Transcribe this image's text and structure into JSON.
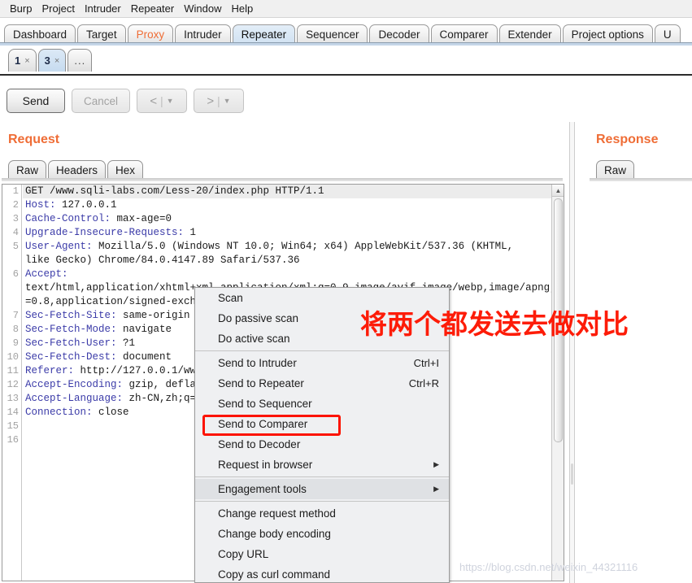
{
  "menubar": {
    "items": [
      {
        "label": "Burp"
      },
      {
        "label": "Project"
      },
      {
        "label": "Intruder"
      },
      {
        "label": "Repeater"
      },
      {
        "label": "Window"
      },
      {
        "label": "Help"
      }
    ]
  },
  "main_tabs": [
    {
      "label": "Dashboard",
      "selected": false,
      "accent": false
    },
    {
      "label": "Target",
      "selected": false,
      "accent": false
    },
    {
      "label": "Proxy",
      "selected": false,
      "accent": true
    },
    {
      "label": "Intruder",
      "selected": false,
      "accent": false
    },
    {
      "label": "Repeater",
      "selected": true,
      "accent": false
    },
    {
      "label": "Sequencer",
      "selected": false,
      "accent": false
    },
    {
      "label": "Decoder",
      "selected": false,
      "accent": false
    },
    {
      "label": "Comparer",
      "selected": false,
      "accent": false
    },
    {
      "label": "Extender",
      "selected": false,
      "accent": false
    },
    {
      "label": "Project options",
      "selected": false,
      "accent": false
    },
    {
      "label": "U",
      "selected": false,
      "accent": false
    }
  ],
  "repeater_tabs": [
    {
      "label": "1",
      "close": "×",
      "selected": false
    },
    {
      "label": "3",
      "close": "×",
      "selected": true
    }
  ],
  "repeater_tabs_more": "...",
  "toolbar": {
    "send_label": "Send",
    "cancel_label": "Cancel",
    "prev_chevron": "<",
    "next_chevron": ">",
    "separator": "|",
    "caret": "▼"
  },
  "request": {
    "title": "Request",
    "tabs": [
      {
        "label": "Raw",
        "selected": true
      },
      {
        "label": "Headers",
        "selected": false
      },
      {
        "label": "Hex",
        "selected": false
      }
    ],
    "line_numbers": [
      "1",
      "2",
      "3",
      "4",
      "5",
      "",
      "6",
      "",
      "",
      "7",
      "8",
      "9",
      "10",
      "11",
      "12",
      "13",
      "14",
      "15",
      "16"
    ],
    "lines": [
      {
        "header": "",
        "text": "GET /www.sqli-labs.com/Less-20/index.php HTTP/1.1",
        "first": true
      },
      {
        "header": "Host:",
        "text": " 127.0.0.1"
      },
      {
        "header": "Cache-Control:",
        "text": " max-age=0"
      },
      {
        "header": "Upgrade-Insecure-Requests:",
        "text": " 1"
      },
      {
        "header": "User-Agent:",
        "text": " Mozilla/5.0 (Windows NT 10.0; Win64; x64) AppleWebKit/537.36 (KHTML,"
      },
      {
        "header": "",
        "text": "like Gecko) Chrome/84.0.4147.89 Safari/537.36"
      },
      {
        "header": "Accept:",
        "text": ""
      },
      {
        "header": "",
        "text": "text/html,application/xhtml+xml,application/xml;q=0.9,image/avif,image/webp,image/apng,*/*;q"
      },
      {
        "header": "",
        "text": "=0.8,application/signed-exchange;v=b3;q=0.9"
      },
      {
        "header": "Sec-Fetch-Site:",
        "text": " same-origin"
      },
      {
        "header": "Sec-Fetch-Mode:",
        "text": " navigate"
      },
      {
        "header": "Sec-Fetch-User:",
        "text": " ?1"
      },
      {
        "header": "Sec-Fetch-Dest:",
        "text": " document"
      },
      {
        "header": "Referer:",
        "text": " http://127.0.0.1/www.sqli-labs.com/Less-20/index.php"
      },
      {
        "header": "Accept-Encoding:",
        "text": " gzip, deflate"
      },
      {
        "header": "Accept-Language:",
        "text": " zh-CN,zh;q=0.9"
      },
      {
        "header": "Connection:",
        "text": " close"
      },
      {
        "header": "",
        "text": ""
      },
      {
        "header": "",
        "text": ""
      }
    ]
  },
  "response": {
    "title": "Response",
    "tabs": [
      {
        "label": "Raw",
        "selected": true
      }
    ]
  },
  "context_menu": {
    "items": [
      {
        "label": "Scan",
        "accel": "",
        "submenu": false,
        "hover": false,
        "separator_after": false
      },
      {
        "label": "Do passive scan",
        "accel": "",
        "submenu": false,
        "hover": false,
        "separator_after": false
      },
      {
        "label": "Do active scan",
        "accel": "",
        "submenu": false,
        "hover": false,
        "separator_after": true
      },
      {
        "label": "Send to Intruder",
        "accel": "Ctrl+I",
        "submenu": false,
        "hover": false,
        "separator_after": false
      },
      {
        "label": "Send to Repeater",
        "accel": "Ctrl+R",
        "submenu": false,
        "hover": false,
        "separator_after": false
      },
      {
        "label": "Send to Sequencer",
        "accel": "",
        "submenu": false,
        "hover": false,
        "separator_after": false
      },
      {
        "label": "Send to Comparer",
        "accel": "",
        "submenu": false,
        "hover": false,
        "separator_after": false
      },
      {
        "label": "Send to Decoder",
        "accel": "",
        "submenu": false,
        "hover": false,
        "separator_after": false
      },
      {
        "label": "Request in browser",
        "accel": "",
        "submenu": true,
        "hover": false,
        "separator_after": true
      },
      {
        "label": "Engagement tools",
        "accel": "",
        "submenu": true,
        "hover": true,
        "separator_after": true
      },
      {
        "label": "Change request method",
        "accel": "",
        "submenu": false,
        "hover": false,
        "separator_after": false
      },
      {
        "label": "Change body encoding",
        "accel": "",
        "submenu": false,
        "hover": false,
        "separator_after": false
      },
      {
        "label": "Copy URL",
        "accel": "",
        "submenu": false,
        "hover": false,
        "separator_after": false
      },
      {
        "label": "Copy as curl command",
        "accel": "",
        "submenu": false,
        "hover": false,
        "separator_after": false
      }
    ],
    "submenu_arrow": "▶"
  },
  "annotation": {
    "text": "将两个都发送去做对比",
    "color": "#fd1c08"
  },
  "highlight_box": {
    "target": "Send to Comparer",
    "color": "#fc1300"
  },
  "watermark": {
    "text": "https://blog.csdn.net/weixin_44321116"
  },
  "colors": {
    "accent": "#ef6d36",
    "selected_tab": "#cfe0f1",
    "header_name": "#3b3ba8",
    "annotation_red": "#fd1c08"
  }
}
